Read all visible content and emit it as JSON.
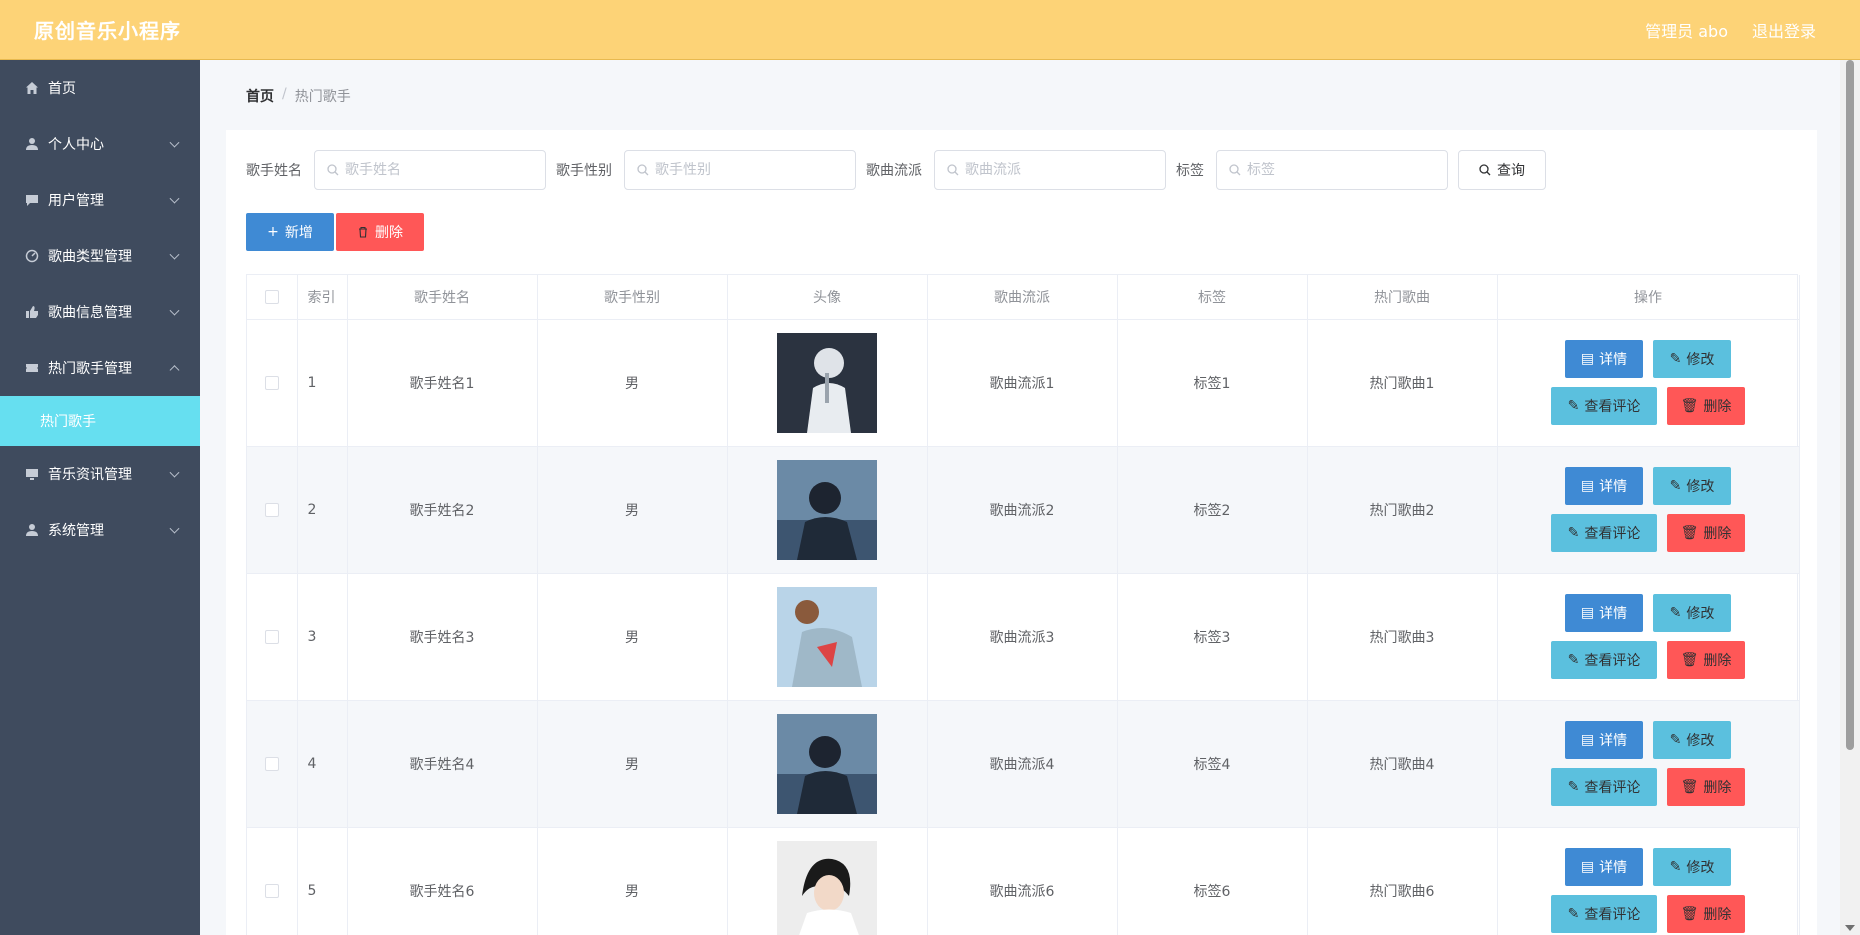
{
  "header": {
    "title": "原创音乐小程序",
    "admin_label": "管理员 abo",
    "logout_label": "退出登录"
  },
  "sidebar": {
    "items": [
      {
        "label": "首页",
        "icon": "home-icon",
        "has_children": false
      },
      {
        "label": "个人中心",
        "icon": "user-icon",
        "has_children": true
      },
      {
        "label": "用户管理",
        "icon": "chat-icon",
        "has_children": true
      },
      {
        "label": "歌曲类型管理",
        "icon": "gauge-icon",
        "has_children": true
      },
      {
        "label": "歌曲信息管理",
        "icon": "thumb-icon",
        "has_children": true
      },
      {
        "label": "热门歌手管理",
        "icon": "ticket-icon",
        "has_children": true,
        "expanded": true
      },
      {
        "label": "音乐资讯管理",
        "icon": "monitor-icon",
        "has_children": true
      },
      {
        "label": "系统管理",
        "icon": "user-icon",
        "has_children": true
      }
    ],
    "active_sub": "热门歌手"
  },
  "breadcrumb": {
    "home": "首页",
    "sep": "/",
    "current": "热门歌手"
  },
  "search": {
    "fields": [
      {
        "label": "歌手姓名",
        "placeholder": "歌手姓名"
      },
      {
        "label": "歌手性别",
        "placeholder": "歌手性别"
      },
      {
        "label": "歌曲流派",
        "placeholder": "歌曲流派"
      },
      {
        "label": "标签",
        "placeholder": "标签"
      }
    ],
    "query_label": "查询"
  },
  "actions": {
    "add_label": "新增",
    "delete_label": "删除"
  },
  "table": {
    "columns": [
      "索引",
      "歌手姓名",
      "歌手性别",
      "头像",
      "歌曲流派",
      "标签",
      "热门歌曲",
      "操作"
    ],
    "rows": [
      {
        "index": "1",
        "name": "歌手姓名1",
        "gender": "男",
        "genre": "歌曲流派1",
        "tag": "标签1",
        "song": "热门歌曲1"
      },
      {
        "index": "2",
        "name": "歌手姓名2",
        "gender": "男",
        "genre": "歌曲流派2",
        "tag": "标签2",
        "song": "热门歌曲2"
      },
      {
        "index": "3",
        "name": "歌手姓名3",
        "gender": "男",
        "genre": "歌曲流派3",
        "tag": "标签3",
        "song": "热门歌曲3"
      },
      {
        "index": "4",
        "name": "歌手姓名4",
        "gender": "男",
        "genre": "歌曲流派4",
        "tag": "标签4",
        "song": "热门歌曲4"
      },
      {
        "index": "5",
        "name": "歌手姓名6",
        "gender": "男",
        "genre": "歌曲流派6",
        "tag": "标签6",
        "song": "热门歌曲6"
      }
    ],
    "op_labels": {
      "detail": "详情",
      "edit": "修改",
      "review": "查看评论",
      "delete": "删除"
    }
  },
  "colors": {
    "header_bg": "#fdd377",
    "sidebar_bg": "#3f4b5e",
    "active_sub_bg": "#66dff0",
    "primary": "#3f8ad4",
    "info": "#5bc0de",
    "danger": "#ff5757"
  }
}
